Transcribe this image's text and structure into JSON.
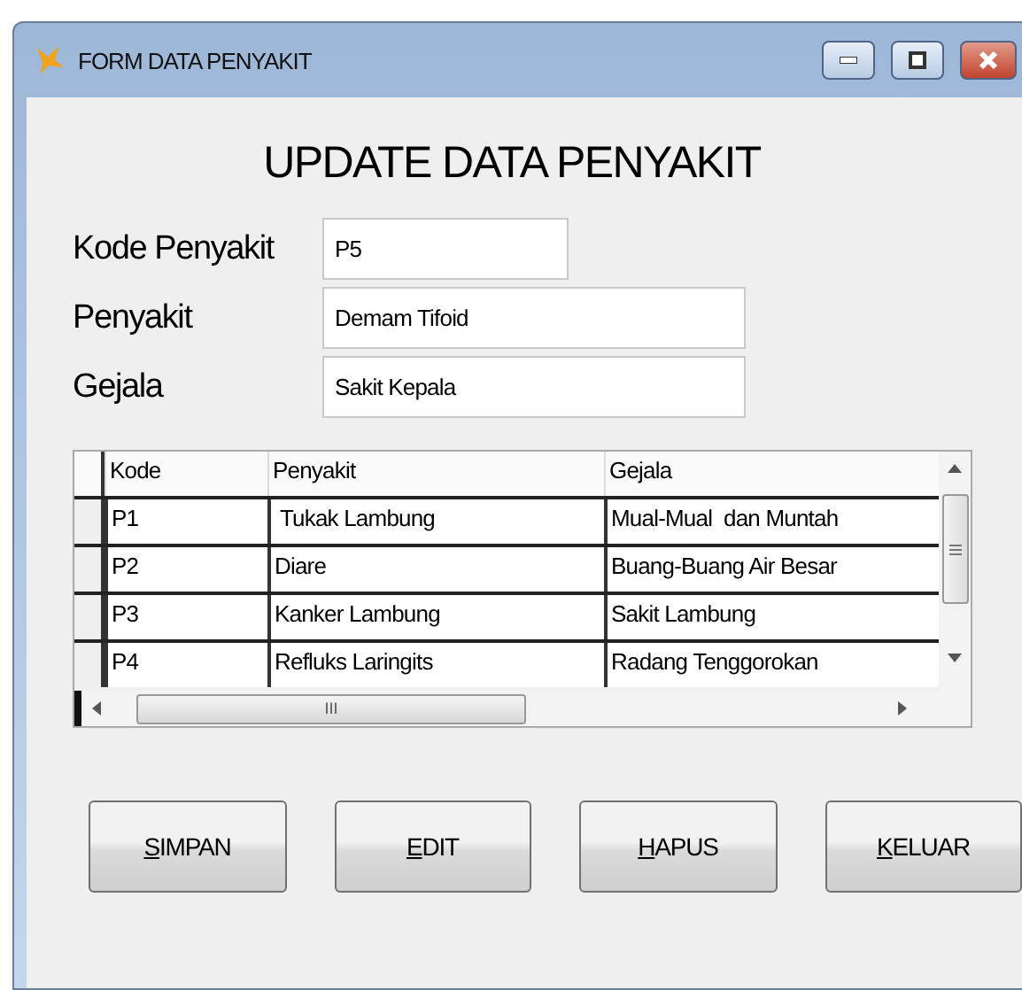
{
  "window": {
    "title": "FORM DATA PENYAKIT"
  },
  "heading": "UPDATE DATA PENYAKIT",
  "fields": [
    {
      "label": "Kode Penyakit",
      "value": "P5",
      "kind": "short"
    },
    {
      "label": "Penyakit",
      "value": "Demam Tifoid",
      "kind": "long"
    },
    {
      "label": "Gejala",
      "value": "Sakit Kepala",
      "kind": "long"
    }
  ],
  "table": {
    "columns": [
      "Kode",
      "Penyakit",
      "Gejala"
    ],
    "rows": [
      [
        "P1",
        " Tukak Lambung",
        "Mual-Mual  dan Muntah"
      ],
      [
        "P2",
        "Diare",
        "Buang-Buang Air Besar"
      ],
      [
        "P3",
        "Kanker Lambung",
        "Sakit Lambung"
      ],
      [
        "P4",
        "Refluks Laringits",
        "Radang Tenggorokan"
      ]
    ],
    "scroll_grip": "III"
  },
  "buttons": [
    "SIMPAN",
    "EDIT",
    "HAPUS",
    "KELUAR"
  ]
}
